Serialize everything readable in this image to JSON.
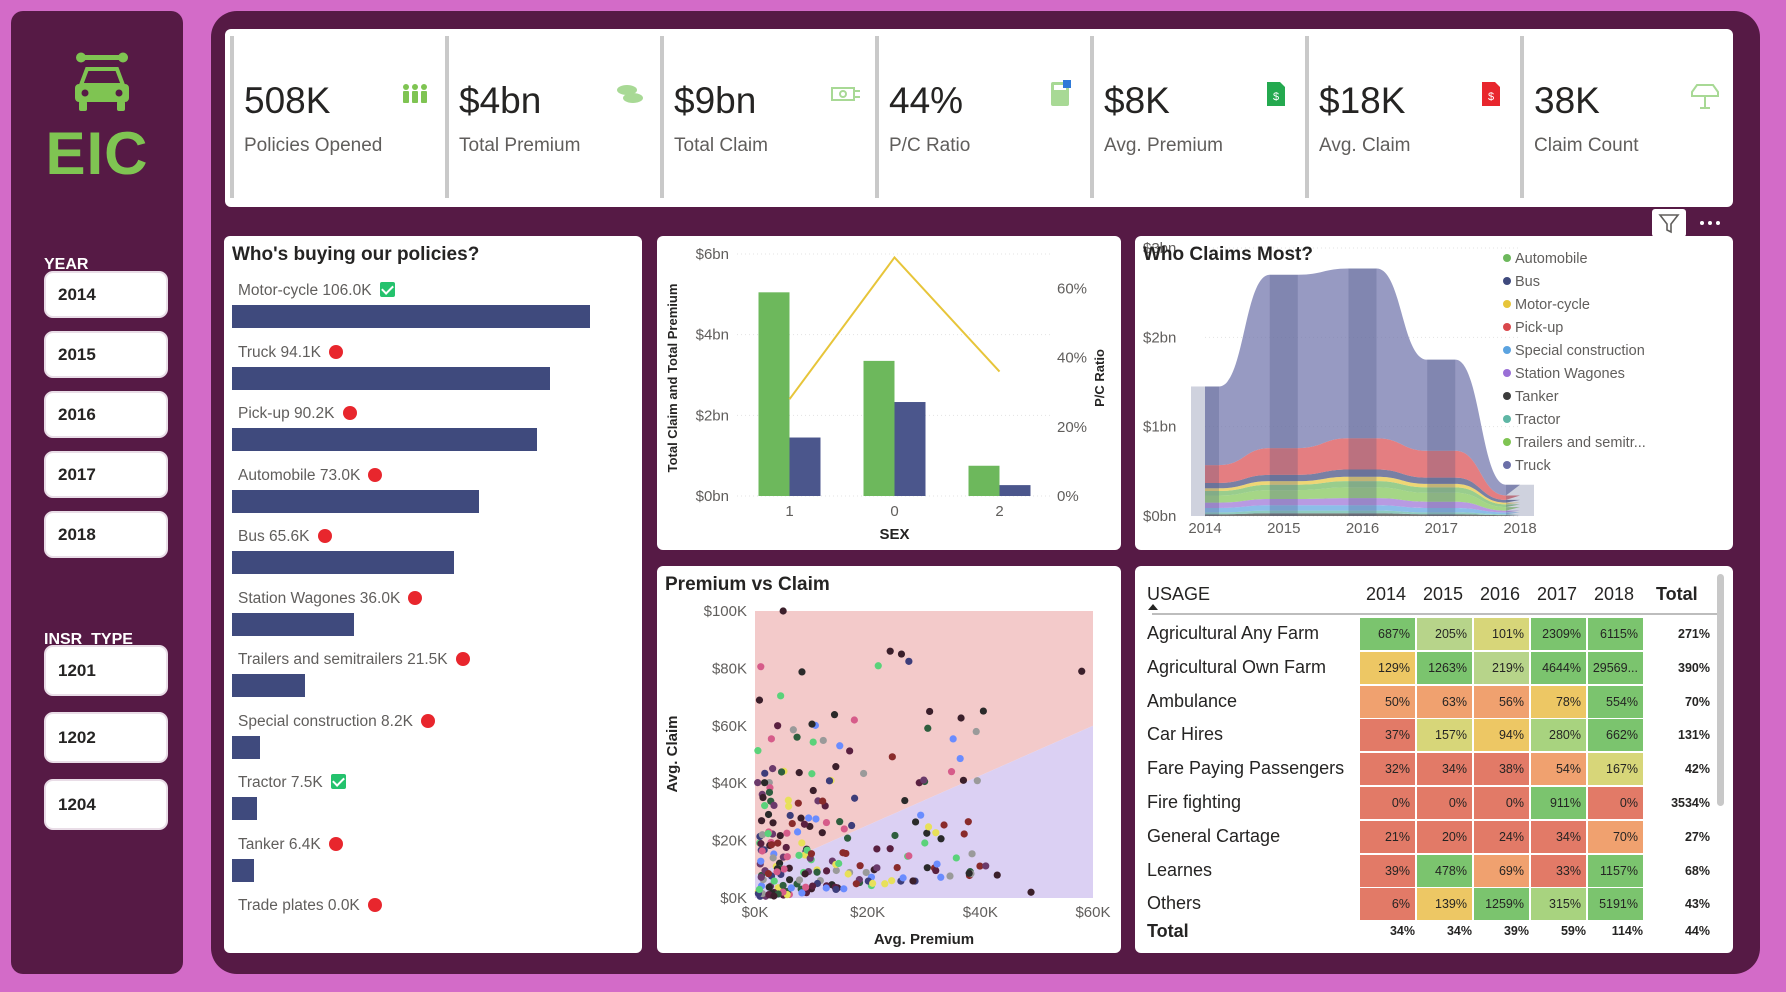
{
  "sidebar": {
    "logo_text": "EIC",
    "year_heading": "YEAR",
    "years": [
      "2014",
      "2015",
      "2016",
      "2017",
      "2018"
    ],
    "insr_heading": "INSR_TYPE",
    "insr_types": [
      "1201",
      "1202",
      "1204"
    ]
  },
  "kpis": [
    {
      "value": "508K",
      "label": "Policies Opened",
      "icon": "people-icon"
    },
    {
      "value": "$4bn",
      "label": "Total Premium",
      "icon": "coins-icon"
    },
    {
      "value": "$9bn",
      "label": "Total Claim",
      "icon": "cash-icon"
    },
    {
      "value": "44%",
      "label": "P/C Ratio",
      "icon": "calculator-icon"
    },
    {
      "value": "$8K",
      "label": "Avg. Premium",
      "icon": "document-dollar-icon"
    },
    {
      "value": "$18K",
      "label": "Avg. Claim",
      "icon": "document-claim-icon"
    },
    {
      "value": "38K",
      "label": "Claim Count",
      "icon": "car-crash-icon"
    }
  ],
  "colors": {
    "bar_navy": "#3f4a7d",
    "green": "#6db85c",
    "yellow": "#e7c53a",
    "alert_red": "#e8262d",
    "ok_green": "#24c26d"
  },
  "buyers": {
    "title": "Who's buying our policies?",
    "items": [
      {
        "label": "Motor-cycle 106.0K",
        "value": 106.0,
        "flag": "ok"
      },
      {
        "label": "Truck 94.1K",
        "value": 94.1,
        "flag": "alert"
      },
      {
        "label": "Pick-up 90.2K",
        "value": 90.2,
        "flag": "alert"
      },
      {
        "label": "Automobile 73.0K",
        "value": 73.0,
        "flag": "alert"
      },
      {
        "label": "Bus 65.6K",
        "value": 65.6,
        "flag": "alert"
      },
      {
        "label": "Station Wagones 36.0K",
        "value": 36.0,
        "flag": "alert"
      },
      {
        "label": "Trailers and semitrailers 21.5K",
        "value": 21.5,
        "flag": "alert"
      },
      {
        "label": "Special construction 8.2K",
        "value": 8.2,
        "flag": "alert"
      },
      {
        "label": "Tractor 7.5K",
        "value": 7.5,
        "flag": "ok"
      },
      {
        "label": "Tanker 6.4K",
        "value": 6.4,
        "flag": "alert"
      },
      {
        "label": "Trade plates 0.0K",
        "value": 0.0,
        "flag": "alert"
      }
    ]
  },
  "chart_data": [
    {
      "type": "bar",
      "title": "",
      "xlabel": "SEX",
      "ylabel": "Total Claim and Total Premium",
      "y2label": "P/C Ratio",
      "categories": [
        "1",
        "0",
        "2"
      ],
      "yticks": [
        "$0bn",
        "$2bn",
        "$4bn",
        "$6bn"
      ],
      "y2ticks": [
        "0%",
        "20%",
        "40%",
        "60%"
      ],
      "ylim": [
        0,
        6
      ],
      "y2lim": [
        0,
        70
      ],
      "series": [
        {
          "values": [
            5.05,
            3.35,
            0.75
          ],
          "color": "#6db85c",
          "kind": "bar"
        },
        {
          "values": [
            1.45,
            2.33,
            0.27
          ],
          "color": "#4b568c",
          "kind": "bar"
        },
        {
          "values": [
            28,
            69,
            36
          ],
          "color": "#e7c53a",
          "kind": "line",
          "axis": "right"
        }
      ]
    },
    {
      "type": "area",
      "title": "Who Claims Most?",
      "x": [
        "2014",
        "2015",
        "2016",
        "2017",
        "2018"
      ],
      "yticks": [
        "$0bn",
        "$1bn",
        "$2bn",
        "$3bn"
      ],
      "ylim": [
        0,
        3
      ],
      "legend_position": "right",
      "series": [
        {
          "name": "Automobile",
          "color": "#6db85c",
          "values": [
            0.05,
            0.06,
            0.07,
            0.06,
            0.03
          ]
        },
        {
          "name": "Bus",
          "color": "#3f4a7d",
          "values": [
            0.06,
            0.07,
            0.08,
            0.07,
            0.03
          ]
        },
        {
          "name": "Motor-cycle",
          "color": "#e7c53a",
          "values": [
            0.03,
            0.04,
            0.05,
            0.04,
            0.02
          ]
        },
        {
          "name": "Pick-up",
          "color": "#d9474b",
          "values": [
            0.2,
            0.3,
            0.35,
            0.3,
            0.05
          ]
        },
        {
          "name": "Special construction",
          "color": "#5ba3e0",
          "values": [
            0.05,
            0.06,
            0.06,
            0.05,
            0.02
          ]
        },
        {
          "name": "Station Wagones",
          "color": "#9a6fd6",
          "values": [
            0.06,
            0.07,
            0.08,
            0.07,
            0.02
          ]
        },
        {
          "name": "Tanker",
          "color": "#3c3c3c",
          "values": [
            0.02,
            0.03,
            0.03,
            0.02,
            0.01
          ]
        },
        {
          "name": "Tractor",
          "color": "#5fb6a5",
          "values": [
            0.02,
            0.03,
            0.03,
            0.02,
            0.01
          ]
        },
        {
          "name": "Trailers and semitr...",
          "color": "#7fc452",
          "values": [
            0.08,
            0.1,
            0.12,
            0.1,
            0.04
          ]
        },
        {
          "name": "Truck",
          "color": "#6b6fa8",
          "values": [
            0.88,
            1.94,
            1.9,
            1.02,
            0.12
          ]
        }
      ]
    },
    {
      "type": "scatter",
      "title": "Premium vs Claim",
      "xlabel": "Avg. Premium",
      "ylabel": "Avg. Claim",
      "xticks": [
        "$0K",
        "$20K",
        "$40K",
        "$60K"
      ],
      "yticks": [
        "$0K",
        "$20K",
        "$40K",
        "$60K",
        "$80K",
        "$100K"
      ],
      "xlim": [
        0,
        60
      ],
      "ylim": [
        0,
        100
      ]
    }
  ],
  "matrix": {
    "corner": "USAGE",
    "columns": [
      "2014",
      "2015",
      "2016",
      "2017",
      "2018"
    ],
    "total_label": "Total",
    "rows": [
      {
        "label": "Agricultural Any Farm",
        "cells": [
          "687%",
          "205%",
          "101%",
          "2309%",
          "6115%"
        ],
        "colors": [
          "#7bc46e",
          "#b7d48a",
          "#d7d679",
          "#7bc46e",
          "#7bc46e"
        ],
        "total": "271%"
      },
      {
        "label": "Agricultural Own Farm",
        "cells": [
          "129%",
          "1263%",
          "219%",
          "4644%",
          "29569..."
        ],
        "colors": [
          "#edc764",
          "#7bc46e",
          "#b7d48a",
          "#7bc46e",
          "#7bc46e"
        ],
        "total": "390%"
      },
      {
        "label": "Ambulance",
        "cells": [
          "50%",
          "63%",
          "56%",
          "78%",
          "554%"
        ],
        "colors": [
          "#f0a16f",
          "#f0a16f",
          "#f0a16f",
          "#edc764",
          "#7bc46e"
        ],
        "total": "70%"
      },
      {
        "label": "Car Hires",
        "cells": [
          "37%",
          "157%",
          "94%",
          "280%",
          "662%"
        ],
        "colors": [
          "#e27a67",
          "#d7d679",
          "#edc764",
          "#a8d37f",
          "#7bc46e"
        ],
        "total": "131%"
      },
      {
        "label": "Fare Paying Passengers",
        "cells": [
          "32%",
          "34%",
          "38%",
          "54%",
          "167%"
        ],
        "colors": [
          "#e27a67",
          "#e27a67",
          "#e27a67",
          "#f0a16f",
          "#d7d679"
        ],
        "total": "42%"
      },
      {
        "label": "Fire fighting",
        "cells": [
          "0%",
          "0%",
          "0%",
          "911%",
          "0%"
        ],
        "colors": [
          "#e27a67",
          "#e27a67",
          "#e27a67",
          "#7bc46e",
          "#e27a67"
        ],
        "total": "3534%"
      },
      {
        "label": "General Cartage",
        "cells": [
          "21%",
          "20%",
          "24%",
          "34%",
          "70%"
        ],
        "colors": [
          "#e27a67",
          "#e27a67",
          "#e27a67",
          "#e27a67",
          "#f0a16f"
        ],
        "total": "27%"
      },
      {
        "label": "Learnes",
        "cells": [
          "39%",
          "478%",
          "69%",
          "33%",
          "1157%"
        ],
        "colors": [
          "#e27a67",
          "#7bc46e",
          "#f0a16f",
          "#e27a67",
          "#7bc46e"
        ],
        "total": "68%"
      },
      {
        "label": "Others",
        "cells": [
          "6%",
          "139%",
          "1259%",
          "315%",
          "5191%"
        ],
        "colors": [
          "#e27a67",
          "#edc764",
          "#7bc46e",
          "#a8d37f",
          "#7bc46e"
        ],
        "total": "43%"
      }
    ],
    "grand_total": {
      "label": "Total",
      "cells": [
        "34%",
        "34%",
        "39%",
        "59%",
        "114%"
      ],
      "total": "44%"
    }
  }
}
